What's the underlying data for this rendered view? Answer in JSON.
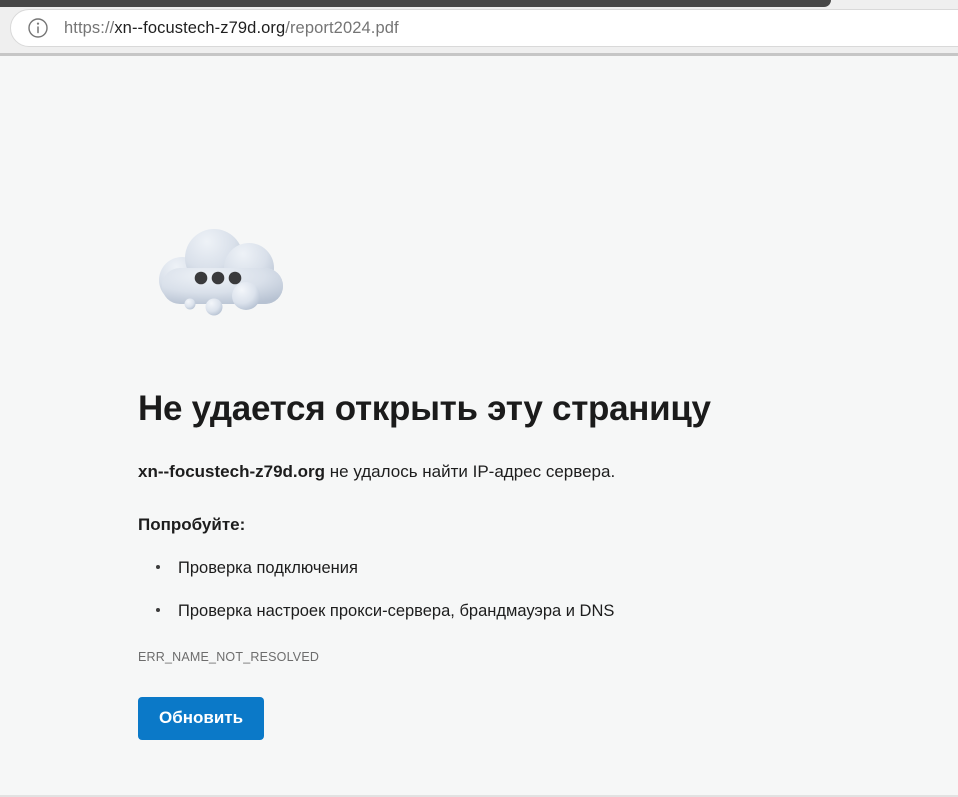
{
  "browser": {
    "url": {
      "scheme": "https://",
      "host": "xn--focustech-z79d.org",
      "path": "/report2024.pdf"
    }
  },
  "error_page": {
    "title": "Не удается открыть эту страницу",
    "subtitle_host": "xn--focustech-z79d.org",
    "subtitle_rest": " не удалось найти IP-адрес сервера.",
    "try_label": "Попробуйте:",
    "suggestions": [
      "Проверка подключения",
      "Проверка настроек прокси-сервера, брандмауэра и DNS"
    ],
    "error_code": "ERR_NAME_NOT_RESOLVED",
    "refresh_button_label": "Обновить"
  },
  "colors": {
    "accent_blue": "#0b79c8",
    "chrome_background": "#efefef",
    "page_background": "#f6f7f7",
    "top_strip": "#474747",
    "text_primary": "#1d1d1d",
    "text_muted": "#757575"
  },
  "icons": {
    "info_icon": "circled letter i (page info)",
    "cloud_illustration": "3d cloud with three dots and bubbles (error illustration)"
  }
}
